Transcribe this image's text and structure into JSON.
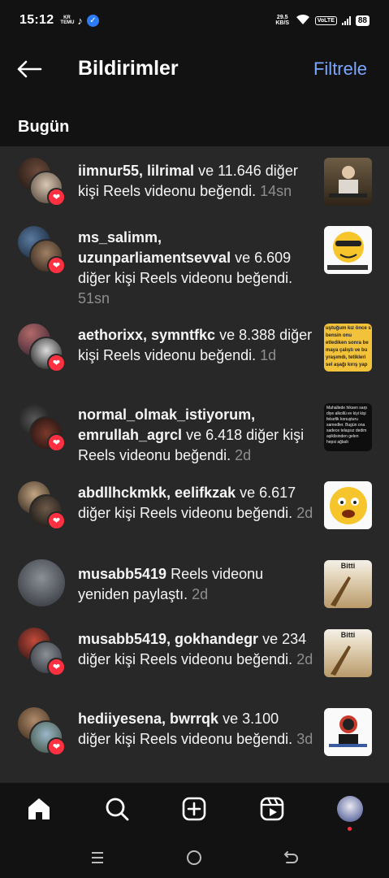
{
  "status_bar": {
    "time": "15:12",
    "temu_label": "KR TEMU",
    "net_speed": "29.5 KB/S",
    "volte": "VoLTE",
    "battery": "88"
  },
  "header": {
    "title": "Bildirimler",
    "filter_label": "Filtrele"
  },
  "section": {
    "today": "Bugün"
  },
  "notifications": [
    {
      "users": "iimnur55, lilrimal",
      "rest": " ve 11.646 diğer kişi Reels videonu beğendi.",
      "time": "14sn"
    },
    {
      "users": "ms_salimm, uzunparliamentsevval",
      "rest": " ve 6.609 diğer kişi Reels videonu beğendi.",
      "time": "51sn"
    },
    {
      "users": "aethorixx, symntfkc",
      "rest": " ve 8.388 diğer kişi Reels videonu beğendi.",
      "time": "1d"
    },
    {
      "users": "normal_olmak_istiyorum, emrullah_agrcl",
      "rest": " ve 6.418 diğer kişi Reels videonu beğendi.",
      "time": "2d"
    },
    {
      "users": "abdllhckmkk, eelifkzak",
      "rest": " ve 6.617 diğer kişi Reels videonu beğendi.",
      "time": "2d"
    },
    {
      "users": "musabb5419",
      "rest": " Reels videonu yeniden paylaştı.",
      "time": "2d"
    },
    {
      "users": "musabb5419, gokhandegr",
      "rest": " ve 234 diğer kişi Reels videonu beğendi.",
      "time": "2d"
    },
    {
      "users": "hediiyesena, bwrrqk",
      "rest": " ve 3.100 diğer kişi Reels videonu beğendi.",
      "time": "3d"
    }
  ],
  "thumb_texts": {
    "t3": "uştuğum kız önce s\nbensin onu\netlediken sonra be\nmaya çalıştı ve bu\nyraşımdı, tetikleri\nsel aşağı kırış yap",
    "t4": "Mahallede hiksen sarp\ndiye alkollü ev kiyi kişi\nfelsefik konuşturu\nsamedler. Bugün ona\nsadece telaşsız dedim\naşiklisinden gelen\nhepsi ağladı",
    "t6": "Bitti",
    "t7": "Bitti"
  },
  "colors": {
    "background": "#121212",
    "list_bg": "#282828",
    "accent_link": "#7aa7ff",
    "like_badge": "#ff3040",
    "muted_time": "#8e8e8e"
  },
  "nav_icons": [
    "home-icon",
    "search-icon",
    "create-icon",
    "reels-icon",
    "profile-avatar"
  ],
  "android_icons": [
    "recents-icon",
    "home-circle-icon",
    "back-icon"
  ]
}
